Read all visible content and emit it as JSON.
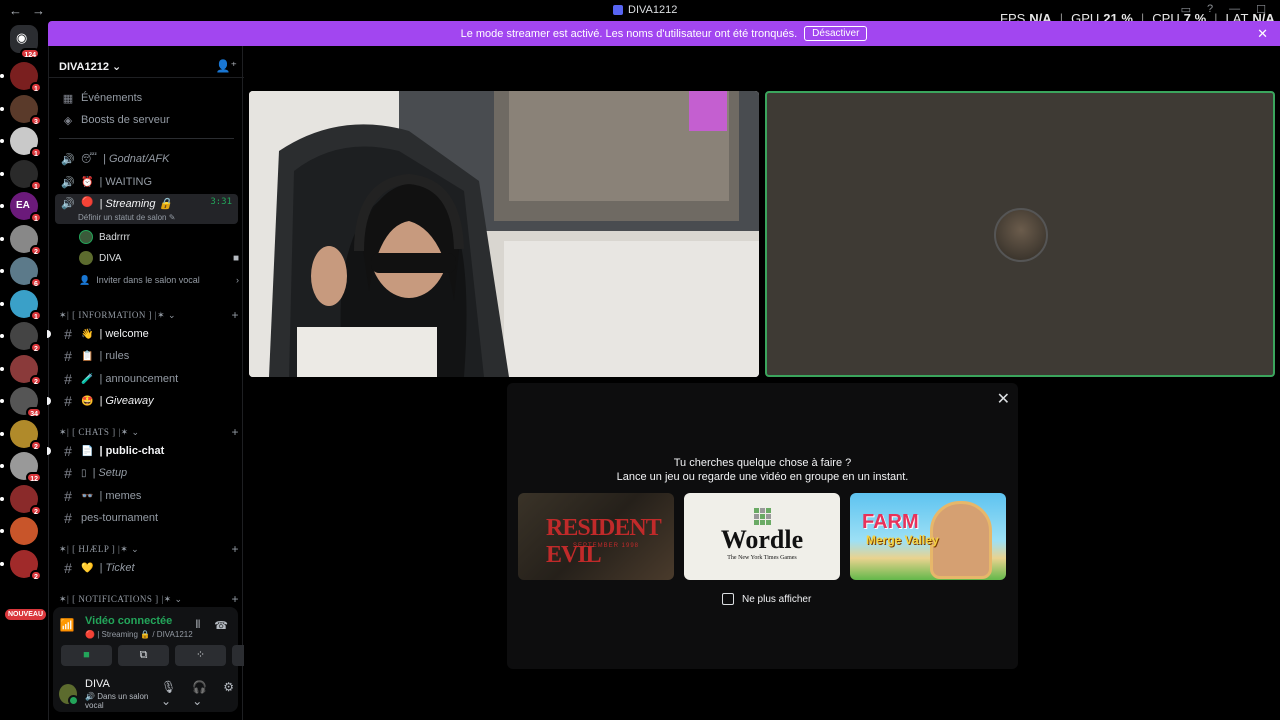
{
  "window": {
    "title": "DIVA1212"
  },
  "stats": {
    "fps_label": "FPS",
    "fps_value": "N/A",
    "gpu_label": "GPU",
    "gpu_value": "21 %",
    "cpu_label": "CPU",
    "cpu_value": "7 %",
    "lat_label": "LAT",
    "lat_value": "N/A"
  },
  "banner": {
    "text": "Le mode streamer est activé. Les noms d'utilisateur ont été tronqués.",
    "button": "Désactiver"
  },
  "rail": {
    "home_badge": "124",
    "servers": [
      {
        "badge": "1"
      },
      {
        "badge": "3"
      },
      {
        "badge": "1"
      },
      {
        "badge": "1"
      },
      {
        "badge": "1",
        "label": "EA"
      },
      {
        "badge": "2"
      },
      {
        "badge": "6"
      },
      {
        "badge": "1"
      },
      {
        "badge": "2"
      },
      {
        "badge": "2"
      },
      {
        "badge": "34"
      },
      {
        "badge": "2"
      },
      {
        "badge": "12"
      },
      {
        "badge": "2"
      },
      {
        "badge": ""
      },
      {
        "badge": "2"
      }
    ],
    "nouveau": "NOUVEAU"
  },
  "sidebar": {
    "server_name": "DIVA1212",
    "events": "Événements",
    "boosts": "Boosts de serveur",
    "voice_channels": [
      {
        "emoji": "😴",
        "name": "| Godnat/AFK"
      },
      {
        "emoji": "⏰",
        "name": "| WAITING"
      },
      {
        "emoji": "🔴",
        "name": "| Streaming",
        "time": "3:31"
      }
    ],
    "set_status": "Définir un statut de salon",
    "voice_users": [
      "Badrrrr",
      "DIVA"
    ],
    "invite": "Inviter dans le salon vocal",
    "categories": [
      {
        "name": "✶| [ INFORMATION ] |✶",
        "channels": [
          {
            "emoji": "👋",
            "name": "| welcome"
          },
          {
            "emoji": "📋",
            "name": "| rules"
          },
          {
            "emoji": "🧪",
            "name": "| announcement"
          },
          {
            "emoji": "🤩",
            "name": "| Giveaway"
          }
        ]
      },
      {
        "name": "✶| [ CHATS ] |✶",
        "channels": [
          {
            "emoji": "📄",
            "name": "| public-chat"
          },
          {
            "emoji": "▯",
            "name": "| Setup"
          },
          {
            "emoji": "👓",
            "name": "| memes"
          },
          {
            "emoji": "",
            "name": "pes-tournament"
          }
        ]
      },
      {
        "name": "✶| [ HJÆLP ] |✶",
        "channels": [
          {
            "emoji": "💛",
            "name": "| Ticket"
          }
        ]
      },
      {
        "name": "✶| [ NOTIFICATIONS ] |✶",
        "channels": []
      }
    ]
  },
  "voice_panel": {
    "title": "Vidéo connectée",
    "channel": "| Streaming 🔒 / DIVA1212",
    "user_name": "DIVA",
    "user_status": "Dans un salon vocal"
  },
  "popup": {
    "line1": "Tu cherches quelque chose à faire ?",
    "line2": "Lance un jeu ou regarde une vidéo en groupe en un instant.",
    "cards": [
      {
        "title": "RESIDENT EVIL",
        "subtitle": "SEPTEMBER 1998"
      },
      {
        "title": "Wordle",
        "subtitle": "The New York Times Games"
      },
      {
        "title": "FARM",
        "subtitle": "Merge Valley"
      }
    ],
    "checkbox_label": "Ne plus afficher"
  },
  "colors": {
    "accent": "#a246f0",
    "online": "#23a55a",
    "badge": "#da373c"
  }
}
